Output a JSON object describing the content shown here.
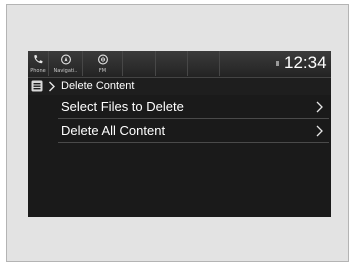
{
  "status_bar": {
    "phone_label": "Phone",
    "navi_label": "Navigati..",
    "fm_label": "FM",
    "clock": "12:34"
  },
  "header": {
    "title": "Delete Content"
  },
  "menu": {
    "items": [
      {
        "label": "Select Files to Delete"
      },
      {
        "label": "Delete All Content"
      }
    ]
  },
  "colors": {
    "screen_background": "#1a1a1a",
    "text": "#ffffff",
    "frame": "#e3e3e3"
  }
}
